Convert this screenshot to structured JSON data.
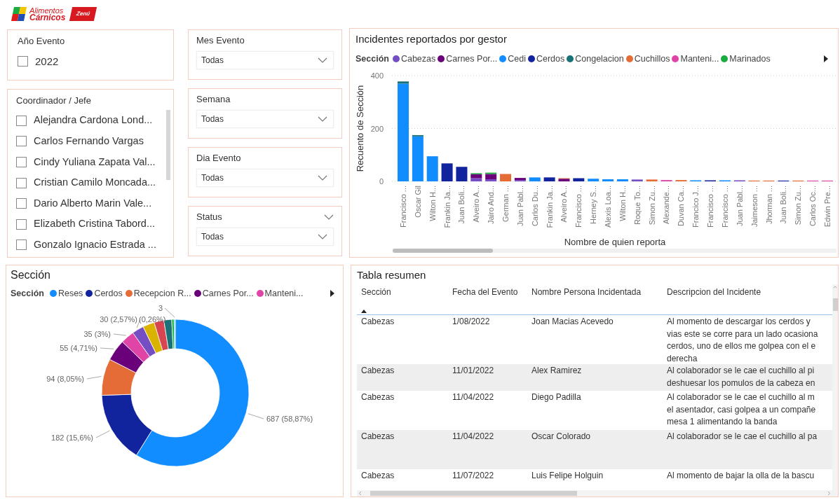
{
  "logo": {
    "lines": [
      "Alimentos",
      "Cárnicos"
    ],
    "badge": "Zenú"
  },
  "filters": {
    "year": {
      "title": "Año Evento",
      "options": [
        {
          "label": "2022",
          "checked": false
        }
      ]
    },
    "coordinator": {
      "title": "Coordinador / Jefe",
      "options": [
        {
          "label": "Alejandra Cardona Lond...",
          "checked": false
        },
        {
          "label": "Carlos Fernando Vargas",
          "checked": false
        },
        {
          "label": "Cindy Yuliana Zapata Val...",
          "checked": false
        },
        {
          "label": "Cristian Camilo Moncada...",
          "checked": false
        },
        {
          "label": "Dario Alberto Marin Vale...",
          "checked": false
        },
        {
          "label": "Elizabeth Cristina Tabord...",
          "checked": false
        },
        {
          "label": "Gonzalo Ignacio Estrada ...",
          "checked": false
        }
      ]
    },
    "dropdowns": [
      {
        "title": "Mes Evento",
        "value": "Todas",
        "header_chevron": false
      },
      {
        "title": "Semana",
        "value": "Todas",
        "header_chevron": false
      },
      {
        "title": "Dia Evento",
        "value": "Todas",
        "header_chevron": false
      },
      {
        "title": "Status",
        "value": "Todas",
        "header_chevron": true
      }
    ]
  },
  "bar_chart": {
    "title": "Incidentes reportados por gestor",
    "legend_title": "Sección",
    "chart_data": {
      "type": "bar",
      "stacked": true,
      "xlabel": "Nombre de quien reporta",
      "ylabel": "Recuento de Sección",
      "ylim": [
        0,
        400
      ],
      "yticks": [
        0,
        200,
        400
      ],
      "categories": [
        "Francisco ...",
        "Oscar Gil",
        "Wilton H...",
        "Frankin Ja...",
        "Juan Boli...",
        "Alveiro A...",
        "Jairo And...",
        "German ...",
        "Juan Pabl...",
        "Carlos Du...",
        "Frankin Ja...",
        "Alveiro A...",
        "Francisco ...",
        "Herney S...",
        "Alexis Loa...",
        "Wilton H...",
        "Roque To...",
        "Simon Zu...",
        "Alexande...",
        "Duvan Ca...",
        "Francico J...",
        "Francisco ...",
        "Francisco ...",
        "Juan Pabl...",
        "Jaimeson ...",
        "Jhorman ...",
        "Juan Boli...",
        "Simon Zu...",
        "Carlos Oc...",
        "Edwin Pre..."
      ],
      "series": [
        {
          "name": "Cabezas",
          "color": "#744ec2",
          "values": [
            0,
            0,
            0,
            0,
            0,
            12,
            8,
            0,
            5,
            0,
            0,
            0,
            0,
            0,
            0,
            0,
            7,
            0,
            0,
            0,
            0,
            0,
            0,
            4,
            0,
            0,
            0,
            0,
            0,
            0
          ]
        },
        {
          "name": "Carnes Por...",
          "color": "#6b007b",
          "values": [
            0,
            0,
            0,
            0,
            0,
            15,
            20,
            0,
            8,
            0,
            0,
            10,
            0,
            0,
            0,
            0,
            0,
            0,
            0,
            0,
            0,
            0,
            0,
            0,
            0,
            0,
            0,
            0,
            0,
            0
          ]
        },
        {
          "name": "Cedi",
          "color": "#118dff",
          "values": [
            370,
            170,
            95,
            0,
            0,
            0,
            0,
            0,
            0,
            15,
            0,
            0,
            0,
            10,
            8,
            8,
            0,
            0,
            0,
            0,
            4,
            0,
            4,
            0,
            0,
            0,
            0,
            0,
            0,
            0
          ]
        },
        {
          "name": "Cerdos",
          "color": "#12239e",
          "values": [
            0,
            0,
            0,
            68,
            55,
            0,
            0,
            0,
            0,
            0,
            15,
            0,
            12,
            0,
            0,
            0,
            0,
            0,
            0,
            0,
            0,
            4,
            0,
            0,
            0,
            0,
            3,
            0,
            0,
            0
          ]
        },
        {
          "name": "Congelacion",
          "color": "#197278",
          "values": [
            8,
            5,
            0,
            0,
            0,
            0,
            0,
            0,
            0,
            0,
            0,
            0,
            0,
            0,
            0,
            0,
            0,
            0,
            0,
            0,
            0,
            0,
            0,
            0,
            0,
            0,
            0,
            0,
            0,
            0
          ]
        },
        {
          "name": "Cuchillos",
          "color": "#e66c37",
          "values": [
            0,
            0,
            0,
            0,
            0,
            0,
            0,
            28,
            0,
            0,
            0,
            2,
            0,
            0,
            0,
            0,
            0,
            7,
            0,
            5,
            0,
            0,
            0,
            0,
            3,
            3,
            0,
            3,
            0,
            0
          ]
        },
        {
          "name": "Manteni...",
          "color": "#e044a7",
          "values": [
            0,
            0,
            0,
            0,
            0,
            0,
            0,
            0,
            0,
            0,
            0,
            0,
            0,
            0,
            0,
            0,
            0,
            0,
            5,
            0,
            0,
            0,
            0,
            0,
            0,
            0,
            0,
            0,
            3,
            3
          ]
        },
        {
          "name": "Marinados",
          "color": "#1aab40",
          "values": [
            0,
            0,
            0,
            0,
            0,
            4,
            5,
            0,
            0,
            0,
            0,
            0,
            0,
            0,
            0,
            0,
            0,
            0,
            0,
            0,
            0,
            0,
            0,
            0,
            0,
            0,
            0,
            0,
            0,
            0
          ]
        }
      ]
    }
  },
  "donut_chart": {
    "title": "Sección",
    "legend_title": "Sección",
    "chart_data": {
      "type": "donut",
      "categories": [
        "Reses",
        "Cerdos",
        "Recepcion R...",
        "Carnes Por...",
        "Manteni...",
        null,
        null,
        null,
        null,
        null,
        null
      ],
      "colors": [
        "#118dff",
        "#12239e",
        "#e66c37",
        "#6b007b",
        "#e044a7",
        "#744ec2",
        "#d9b300",
        "#d64550",
        "#197278",
        "#1aab40",
        "#15c6f4"
      ],
      "values": [
        687,
        182,
        94,
        55,
        35,
        30,
        30,
        25,
        20,
        6,
        3
      ],
      "value_labels": [
        "687 (58,87%)",
        "182 (15,6%)",
        "94 (8,05%)",
        "55 (4,71%)",
        "35 (3%)",
        "30 (2,57%)",
        null,
        null,
        null,
        null,
        "3"
      ],
      "annotations": [
        {
          "text": "(0,26%)"
        }
      ]
    }
  },
  "table": {
    "title": "Tabla resumen",
    "columns": [
      {
        "label": "Sección",
        "sorted": true
      },
      {
        "label": "Fecha del Evento",
        "sorted": false
      },
      {
        "label": "Nombre Persona Incidentada",
        "sorted": false
      },
      {
        "label": "Descripcion del Incidente",
        "sorted": false
      }
    ],
    "rows": [
      {
        "seccion": "Cabezas",
        "fecha": "1/08/2022",
        "persona": "Joan Macias Acevedo",
        "descripcion": [
          "Al momento de descargar los cerdos y",
          "vias este se corre para un lado ocasiona",
          "cerdos, uno de ellos me golpea con el e",
          "derecha"
        ]
      },
      {
        "seccion": "Cabezas",
        "fecha": "11/01/2022",
        "persona": "Alex Ramirez",
        "descripcion": [
          "Al colaborador se le cae el cuchillo al pi",
          "deshuesar los pomulos de la cabeza en"
        ]
      },
      {
        "seccion": "Cabezas",
        "fecha": "11/04/2022",
        "persona": "Diego Padilla",
        "descripcion": [
          "Al colaborador se le cae el cuchillo al m",
          "el asentador, casi golpea a un compañe",
          "mesa 1 alimentando la banda"
        ]
      },
      {
        "seccion": "Cabezas",
        "fecha": "11/04/2022",
        "persona": "Oscar Colorado",
        "descripcion": [
          "Al colaborador se le cae el cuchillo al pa"
        ]
      },
      {
        "seccion": "Cabezas",
        "fecha": "11/07/2022",
        "persona": "Luis Felipe Holguin",
        "descripcion": [
          "Al momento de bajar la olla de la bascu"
        ]
      }
    ]
  }
}
